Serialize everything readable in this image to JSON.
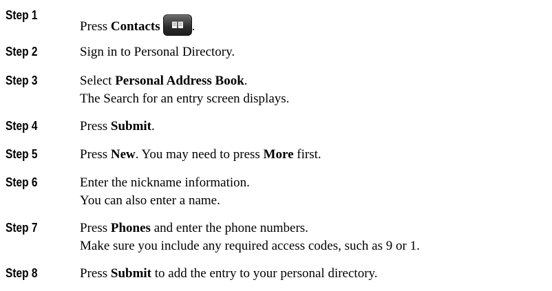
{
  "steps": [
    {
      "label": "Step 1",
      "segments": [
        {
          "text": "Press "
        },
        {
          "text": "Contacts",
          "bold": true
        }
      ],
      "button_icon": "book-icon",
      "tail": "."
    },
    {
      "label": "Step 2",
      "segments": [
        {
          "text": "Sign in to Personal Directory."
        }
      ]
    },
    {
      "label": "Step 3",
      "segments": [
        {
          "text": "Select "
        },
        {
          "text": "Personal Address Book",
          "bold": true
        },
        {
          "text": "."
        }
      ],
      "detail": "The Search for an entry screen displays."
    },
    {
      "label": "Step 4",
      "segments": [
        {
          "text": "Press "
        },
        {
          "text": "Submit",
          "bold": true
        },
        {
          "text": "."
        }
      ]
    },
    {
      "label": "Step 5",
      "segments": [
        {
          "text": "Press "
        },
        {
          "text": "New",
          "bold": true
        },
        {
          "text": ". You may need to press "
        },
        {
          "text": "More",
          "bold": true
        },
        {
          "text": " first."
        }
      ]
    },
    {
      "label": "Step 6",
      "segments": [
        {
          "text": "Enter the nickname information."
        }
      ],
      "detail": "You can also enter a name."
    },
    {
      "label": "Step 7",
      "segments": [
        {
          "text": "Press "
        },
        {
          "text": "Phones",
          "bold": true
        },
        {
          "text": " and enter the phone numbers."
        }
      ],
      "detail": "Make sure you include any required access codes, such as 9 or 1."
    },
    {
      "label": "Step 8",
      "segments": [
        {
          "text": "Press "
        },
        {
          "text": "Submit",
          "bold": true
        },
        {
          "text": " to add the entry to your personal directory."
        }
      ]
    }
  ]
}
